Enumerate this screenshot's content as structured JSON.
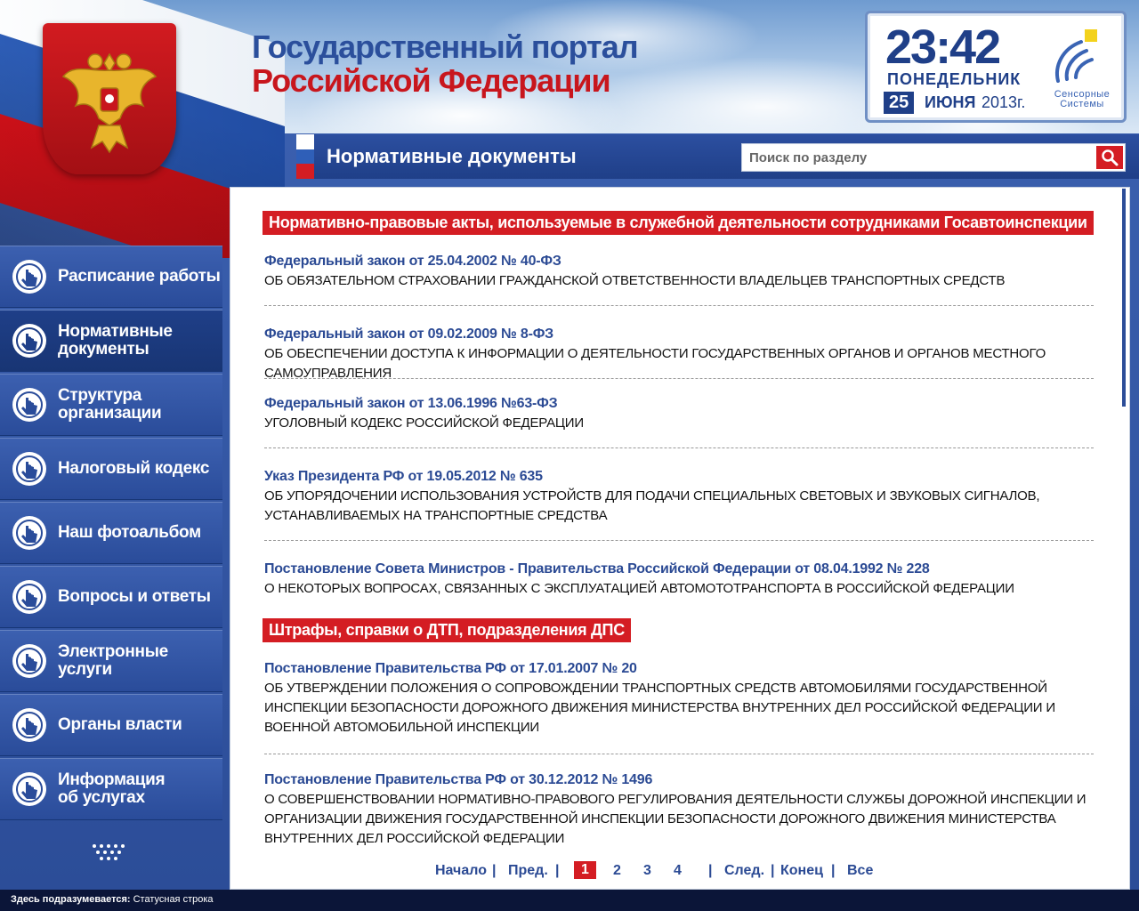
{
  "header": {
    "title_line1": "Государственный портал",
    "title_line2": "Российской Федерации"
  },
  "clock": {
    "time": "23:42",
    "weekday": "ПОНЕДЕЛЬНИК",
    "day": "25",
    "month": "ИЮНЯ",
    "year": "2013г.",
    "brand_line1": "Сенсорные",
    "brand_line2": "Системы"
  },
  "section": {
    "title": "Нормативные документы",
    "search_placeholder": "Поиск по разделу"
  },
  "sidebar": {
    "items": [
      {
        "label": "Расписание работы",
        "active": false
      },
      {
        "label": "Нормативные\nдокументы",
        "active": true
      },
      {
        "label": "Структура\nорганизации",
        "active": false
      },
      {
        "label": "Налоговый кодекс",
        "active": false
      },
      {
        "label": "Наш фотоальбом",
        "active": false
      },
      {
        "label": "Вопросы и ответы",
        "active": false
      },
      {
        "label": "Электронные\nуслуги",
        "active": false
      },
      {
        "label": "Органы власти",
        "active": false
      },
      {
        "label": "Информация\nоб услугах",
        "active": false
      }
    ]
  },
  "content": {
    "category1": "Нормативно-правовые акты, используемые в служебной деятельности сотрудниками Госавтоинспекции",
    "category2": "Штрафы, справки о ДТП, подразделения ДПС",
    "docs": [
      {
        "title": "Федеральный закон от 25.04.2002 № 40-ФЗ",
        "desc": "ОБ ОБЯЗАТЕЛЬНОМ СТРАХОВАНИИ ГРАЖДАНСКОЙ ОТВЕТСТВЕННОСТИ ВЛАДЕЛЬЦЕВ ТРАНСПОРТНЫХ СРЕДСТВ"
      },
      {
        "title": "Федеральный закон от 09.02.2009 № 8-ФЗ",
        "desc": "ОБ ОБЕСПЕЧЕНИИ ДОСТУПА К ИНФОРМАЦИИ О ДЕЯТЕЛЬНОСТИ ГОСУДАРСТВЕННЫХ ОРГАНОВ И ОРГАНОВ МЕСТНОГО САМОУПРАВЛЕНИЯ"
      },
      {
        "title": "Федеральный закон от 13.06.1996 №63-ФЗ",
        "desc": "УГОЛОВНЫЙ КОДЕКС РОССИЙСКОЙ ФЕДЕРАЦИИ"
      },
      {
        "title": "Указ Президента РФ от 19.05.2012 № 635",
        "desc": "ОБ УПОРЯДОЧЕНИИ ИСПОЛЬЗОВАНИЯ УСТРОЙСТВ ДЛЯ ПОДАЧИ СПЕЦИАЛЬНЫХ СВЕТОВЫХ И ЗВУКОВЫХ СИГНАЛОВ, УСТАНАВЛИВАЕМЫХ НА ТРАНСПОРТНЫЕ СРЕДСТВА"
      },
      {
        "title": "Постановление Совета Министров - Правительства Российской Федерации от 08.04.1992 № 228",
        "desc": "О НЕКОТОРЫХ ВОПРОСАХ, СВЯЗАННЫХ С ЭКСПЛУАТАЦИЕЙ АВТОМОТОТРАНСПОРТА В РОССИЙСКОЙ ФЕДЕРАЦИИ"
      },
      {
        "title": "Постановление Правительства РФ от 17.01.2007 № 20",
        "desc": "ОБ УТВЕРЖДЕНИИ ПОЛОЖЕНИЯ О СОПРОВОЖДЕНИИ ТРАНСПОРТНЫХ СРЕДСТВ АВТОМОБИЛЯМИ ГОСУДАРСТВЕННОЙ ИНСПЕКЦИИ БЕЗОПАСНОСТИ ДОРОЖНОГО ДВИЖЕНИЯ МИНИСТЕРСТВА ВНУТРЕННИХ ДЕЛ РОССИЙСКОЙ ФЕДЕРАЦИИ И ВОЕННОЙ АВТОМОБИЛЬНОЙ ИНСПЕКЦИИ"
      },
      {
        "title": "Постановление Правительства РФ от 30.12.2012 № 1496",
        "desc": "О СОВЕРШЕНСТВОВАНИИ НОРМАТИВНО-ПРАВОВОГО РЕГУЛИРОВАНИЯ ДЕЯТЕЛЬНОСТИ СЛУЖБЫ ДОРОЖНОЙ ИНСПЕКЦИИ И ОРГАНИЗАЦИИ ДВИЖЕНИЯ ГОСУДАРСТВЕННОЙ ИНСПЕКЦИИ БЕЗОПАСНОСТИ ДОРОЖНОГО ДВИЖЕНИЯ МИНИСТЕРСТВА ВНУТРЕННИХ ДЕЛ РОССИЙСКОЙ ФЕДЕРАЦИИ"
      }
    ]
  },
  "pager": {
    "first": "Начало",
    "prev": "Пред.",
    "pages": [
      "1",
      "2",
      "3",
      "4"
    ],
    "current": "1",
    "next": "След.",
    "last": "Конец",
    "all": "Все",
    "sep": "|"
  },
  "status": {
    "label": "Здесь подразумевается:",
    "text": "Статусная строка"
  },
  "colors": {
    "accent_red": "#d41d23",
    "brand_blue": "#2b4a94"
  }
}
